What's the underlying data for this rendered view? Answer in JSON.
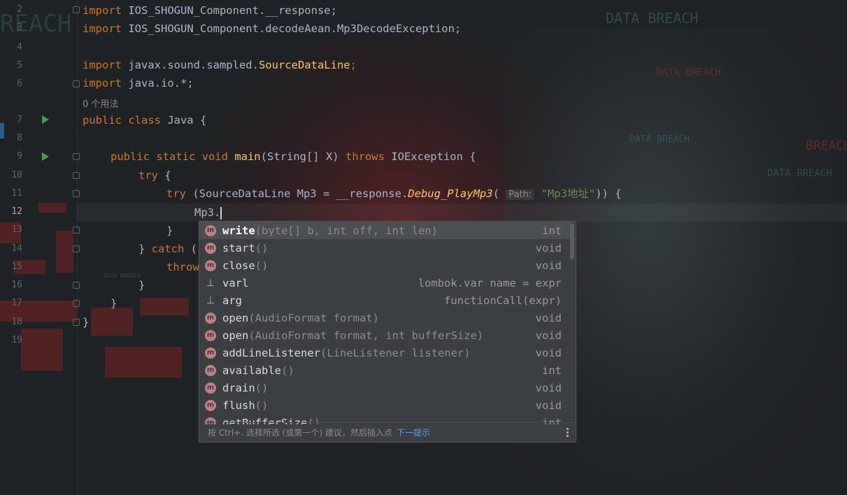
{
  "editor": {
    "line_numbers": [
      "2",
      "3",
      "4",
      "5",
      "6",
      "7",
      "8",
      "9",
      "10",
      "11",
      "12",
      "13",
      "14",
      "15",
      "16",
      "17",
      "18",
      "19"
    ],
    "current_line": "12",
    "usages_hint": "0 个用法",
    "code": {
      "l2": {
        "kw": "import",
        "rest": " IOS_SHOGUN_Component.__response;"
      },
      "l3": {
        "kw": "import",
        "rest": " IOS_SHOGUN_Component.decodeAean.Mp3DecodeException;"
      },
      "l5": {
        "kw": "import",
        "pre": " javax.sound.sampled.",
        "cls": "SourceDataLine",
        "post": ";"
      },
      "l6": {
        "kw": "import",
        "rest": " java.io.*;"
      },
      "l7": {
        "kw": "public class",
        "rest": " Java {"
      },
      "l9": {
        "kw1": "public static void",
        "fn": " main",
        "mid": "(String[] X) ",
        "kw2": "throws",
        "rest": " IOException {"
      },
      "l10": {
        "kw": "try",
        "rest": " {"
      },
      "l11": {
        "kw": "try",
        "pre": " (SourceDataLine Mp3 = __response.",
        "method": "Debug_PlayMp3",
        "open": "(",
        "param_hint": "Path:",
        "str": "\"Mp3地址\"",
        "post": ")) {"
      },
      "l12": {
        "text": "Mp3."
      },
      "l13": {
        "text": "}"
      },
      "l14": {
        "pre": "} ",
        "kw": "catch",
        "rest": " ("
      },
      "l15": {
        "kw": "throw"
      },
      "l16": {
        "text": "}"
      },
      "l17": {
        "text": "}"
      },
      "l18": {
        "text": "}"
      }
    }
  },
  "completion": {
    "items": [
      {
        "icon": "method-icon",
        "name": "write",
        "params": "(byte[] b, int off, int len)",
        "type": "int",
        "selected": true
      },
      {
        "icon": "method-icon",
        "name": "start",
        "params": "()",
        "type": "void"
      },
      {
        "icon": "method-icon",
        "name": "close",
        "params": "()",
        "type": "void"
      },
      {
        "icon": "template-icon",
        "name": "varl",
        "params": "",
        "type": "lombok.var name = expr"
      },
      {
        "icon": "template-icon",
        "name": "arg",
        "params": "",
        "type": "functionCall(expr)"
      },
      {
        "icon": "method-icon",
        "name": "open",
        "params": "(AudioFormat format)",
        "type": "void"
      },
      {
        "icon": "method-icon",
        "name": "open",
        "params": "(AudioFormat format, int bufferSize)",
        "type": "void"
      },
      {
        "icon": "method-icon",
        "name": "addLineListener",
        "params": "(LineListener listener)",
        "type": "void"
      },
      {
        "icon": "method-icon",
        "name": "available",
        "params": "()",
        "type": "int"
      },
      {
        "icon": "method-icon",
        "name": "drain",
        "params": "()",
        "type": "void"
      },
      {
        "icon": "method-icon",
        "name": "flush",
        "params": "()",
        "type": "void"
      },
      {
        "icon": "method-icon",
        "name": "getBufferSize",
        "params": "()",
        "type": "int"
      }
    ],
    "footer_text": "按 Ctrl+. 选择所选 (或第一个) 建议，然后插入点",
    "footer_link": "下一提示"
  },
  "background": {
    "texts": [
      "DATA BREACH",
      "DATA BREACH",
      "DATA BREACH",
      "DATA BREACH",
      "DATA BREACH",
      "REACH",
      "BREACH"
    ]
  }
}
